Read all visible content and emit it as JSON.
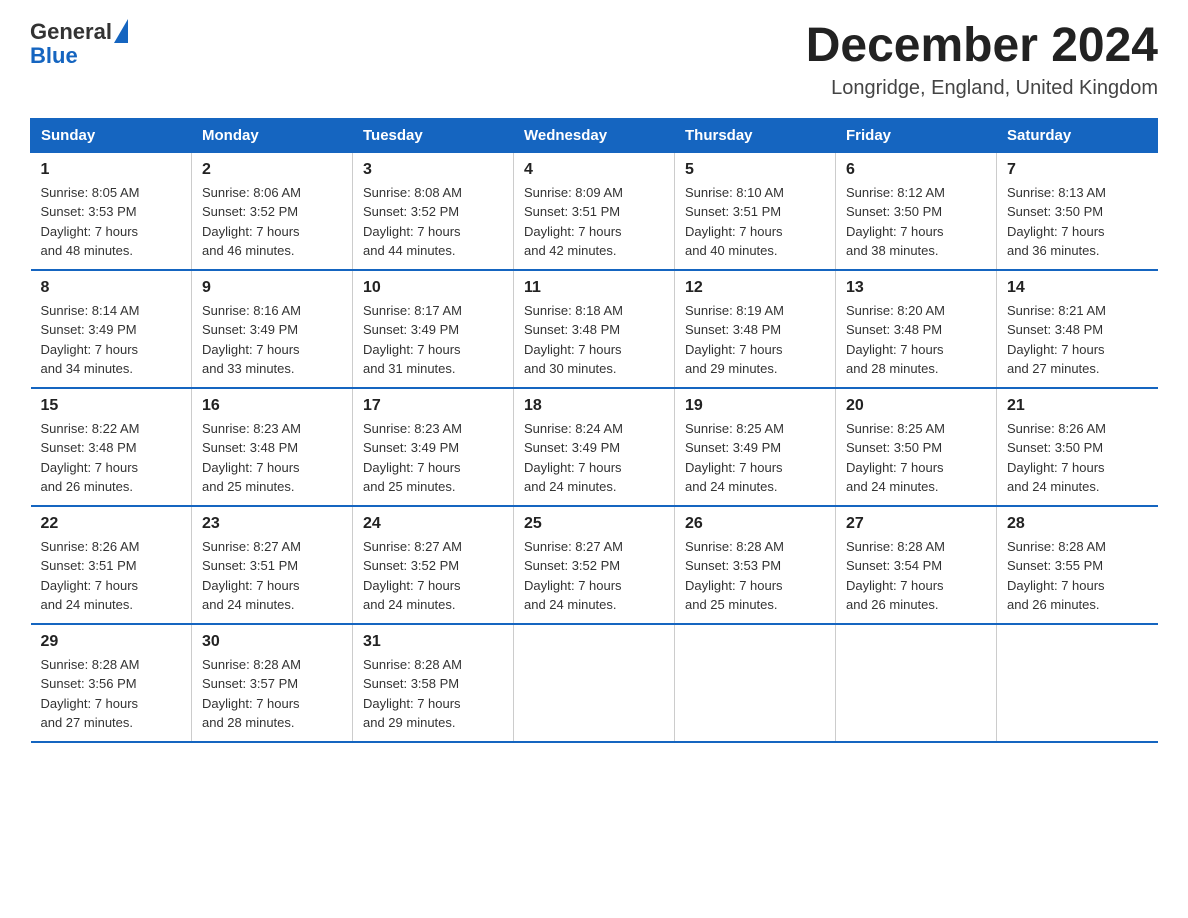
{
  "header": {
    "logo_general": "General",
    "logo_blue": "Blue",
    "title": "December 2024",
    "subtitle": "Longridge, England, United Kingdom"
  },
  "weekdays": [
    "Sunday",
    "Monday",
    "Tuesday",
    "Wednesday",
    "Thursday",
    "Friday",
    "Saturday"
  ],
  "weeks": [
    [
      {
        "day": "1",
        "sunrise": "8:05 AM",
        "sunset": "3:53 PM",
        "daylight": "7 hours and 48 minutes."
      },
      {
        "day": "2",
        "sunrise": "8:06 AM",
        "sunset": "3:52 PM",
        "daylight": "7 hours and 46 minutes."
      },
      {
        "day": "3",
        "sunrise": "8:08 AM",
        "sunset": "3:52 PM",
        "daylight": "7 hours and 44 minutes."
      },
      {
        "day": "4",
        "sunrise": "8:09 AM",
        "sunset": "3:51 PM",
        "daylight": "7 hours and 42 minutes."
      },
      {
        "day": "5",
        "sunrise": "8:10 AM",
        "sunset": "3:51 PM",
        "daylight": "7 hours and 40 minutes."
      },
      {
        "day": "6",
        "sunrise": "8:12 AM",
        "sunset": "3:50 PM",
        "daylight": "7 hours and 38 minutes."
      },
      {
        "day": "7",
        "sunrise": "8:13 AM",
        "sunset": "3:50 PM",
        "daylight": "7 hours and 36 minutes."
      }
    ],
    [
      {
        "day": "8",
        "sunrise": "8:14 AM",
        "sunset": "3:49 PM",
        "daylight": "7 hours and 34 minutes."
      },
      {
        "day": "9",
        "sunrise": "8:16 AM",
        "sunset": "3:49 PM",
        "daylight": "7 hours and 33 minutes."
      },
      {
        "day": "10",
        "sunrise": "8:17 AM",
        "sunset": "3:49 PM",
        "daylight": "7 hours and 31 minutes."
      },
      {
        "day": "11",
        "sunrise": "8:18 AM",
        "sunset": "3:48 PM",
        "daylight": "7 hours and 30 minutes."
      },
      {
        "day": "12",
        "sunrise": "8:19 AM",
        "sunset": "3:48 PM",
        "daylight": "7 hours and 29 minutes."
      },
      {
        "day": "13",
        "sunrise": "8:20 AM",
        "sunset": "3:48 PM",
        "daylight": "7 hours and 28 minutes."
      },
      {
        "day": "14",
        "sunrise": "8:21 AM",
        "sunset": "3:48 PM",
        "daylight": "7 hours and 27 minutes."
      }
    ],
    [
      {
        "day": "15",
        "sunrise": "8:22 AM",
        "sunset": "3:48 PM",
        "daylight": "7 hours and 26 minutes."
      },
      {
        "day": "16",
        "sunrise": "8:23 AM",
        "sunset": "3:48 PM",
        "daylight": "7 hours and 25 minutes."
      },
      {
        "day": "17",
        "sunrise": "8:23 AM",
        "sunset": "3:49 PM",
        "daylight": "7 hours and 25 minutes."
      },
      {
        "day": "18",
        "sunrise": "8:24 AM",
        "sunset": "3:49 PM",
        "daylight": "7 hours and 24 minutes."
      },
      {
        "day": "19",
        "sunrise": "8:25 AM",
        "sunset": "3:49 PM",
        "daylight": "7 hours and 24 minutes."
      },
      {
        "day": "20",
        "sunrise": "8:25 AM",
        "sunset": "3:50 PM",
        "daylight": "7 hours and 24 minutes."
      },
      {
        "day": "21",
        "sunrise": "8:26 AM",
        "sunset": "3:50 PM",
        "daylight": "7 hours and 24 minutes."
      }
    ],
    [
      {
        "day": "22",
        "sunrise": "8:26 AM",
        "sunset": "3:51 PM",
        "daylight": "7 hours and 24 minutes."
      },
      {
        "day": "23",
        "sunrise": "8:27 AM",
        "sunset": "3:51 PM",
        "daylight": "7 hours and 24 minutes."
      },
      {
        "day": "24",
        "sunrise": "8:27 AM",
        "sunset": "3:52 PM",
        "daylight": "7 hours and 24 minutes."
      },
      {
        "day": "25",
        "sunrise": "8:27 AM",
        "sunset": "3:52 PM",
        "daylight": "7 hours and 24 minutes."
      },
      {
        "day": "26",
        "sunrise": "8:28 AM",
        "sunset": "3:53 PM",
        "daylight": "7 hours and 25 minutes."
      },
      {
        "day": "27",
        "sunrise": "8:28 AM",
        "sunset": "3:54 PM",
        "daylight": "7 hours and 26 minutes."
      },
      {
        "day": "28",
        "sunrise": "8:28 AM",
        "sunset": "3:55 PM",
        "daylight": "7 hours and 26 minutes."
      }
    ],
    [
      {
        "day": "29",
        "sunrise": "8:28 AM",
        "sunset": "3:56 PM",
        "daylight": "7 hours and 27 minutes."
      },
      {
        "day": "30",
        "sunrise": "8:28 AM",
        "sunset": "3:57 PM",
        "daylight": "7 hours and 28 minutes."
      },
      {
        "day": "31",
        "sunrise": "8:28 AM",
        "sunset": "3:58 PM",
        "daylight": "7 hours and 29 minutes."
      },
      null,
      null,
      null,
      null
    ]
  ]
}
